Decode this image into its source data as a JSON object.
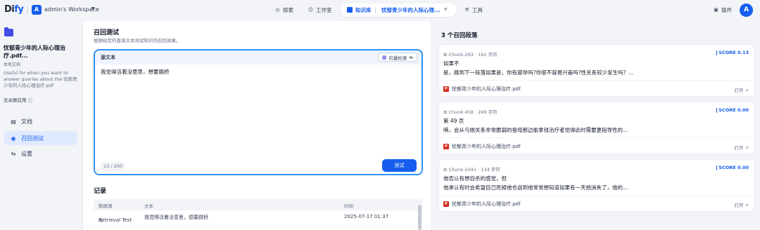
{
  "topbar": {
    "logo_main": "Di",
    "logo_accent": "fy",
    "workspace_initial": "A",
    "workspace_name": "admin's Workspace",
    "nav": {
      "explore": "探索",
      "studio": "工作室",
      "knowledge": "知识库",
      "current_dataset": "忧郁青少年的人际心理...",
      "tools": "工具"
    },
    "plugins": "插件",
    "user_initial": "A"
  },
  "sidebar": {
    "dataset_title": "忧郁青少年的人际心理治疗.pdf...",
    "dataset_type": "本地文档",
    "dataset_desc": "Useful for when you want to answer queries about the 忧郁青少年的人际心理治疗.pdf",
    "related_apps": "无关联应用",
    "items": [
      {
        "label": "文档"
      },
      {
        "label": "召回测试"
      },
      {
        "label": "设置"
      }
    ]
  },
  "retrieval": {
    "title": "召回测试",
    "desc": "根据给定的查询文本测试知识的召回效果。",
    "source_label": "源文本",
    "mode_label": "向量检索",
    "query_text": "我觉得活着没意思，想要跳桥",
    "char_count": "13 / 200",
    "test_button": "测试"
  },
  "records": {
    "title": "记录",
    "headers": {
      "source": "数据源",
      "text": "文本",
      "time": "时间"
    },
    "rows": [
      {
        "source": "Retrieval Test",
        "text": "我觉得活着没意思，想要跳桥",
        "time": "2025-07-17 01:37"
      }
    ]
  },
  "results": {
    "title": "3 个召回段落",
    "open_label": "打开",
    "chunks": [
      {
        "chunk_id": "Chunk-293",
        "chars": "162 字符",
        "score_label": "SCORE",
        "score": "0.13",
        "line1": "如果不",
        "line2": "是，跳到下一段落如果是，你有避孕吗?你很不容易兴奋吗?性关系较少发生吗？...",
        "file": "忧郁青少年的人际心理治疗.pdf"
      },
      {
        "chunk_id": "Chunk-458",
        "chars": "249 字符",
        "score_label": "SCORE",
        "score": "0.00",
        "line1": "第 49 页",
        "line2": "嗬，会从与她关系非常脆弱的祖母那边偷拿钱治疗者觉得此时需要更指导性的...",
        "file": "忧郁青少年的人际心理治疗.pdf"
      },
      {
        "chunk_id": "Chunk-1041",
        "chars": "134 字符",
        "score_label": "SCORE",
        "score": "0.00",
        "line1": "他否认有想自杀的感觉，但",
        "line2": "他承认有时会希望自己死掉他也说到他常常想知道如果有一天他消失了，他的...",
        "file": "忧郁青少年的人际心理治疗.pdf"
      }
    ]
  }
}
